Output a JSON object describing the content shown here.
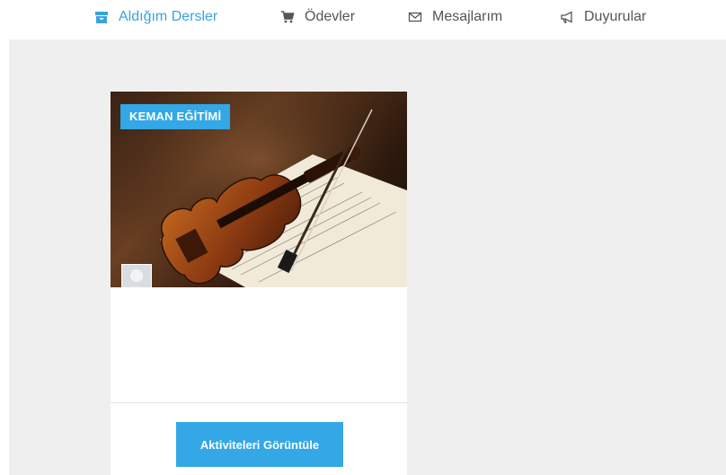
{
  "nav": {
    "tabs": [
      {
        "label": "Aldığım Dersler",
        "icon": "archive-box-icon",
        "active": true
      },
      {
        "label": "Ödevler",
        "icon": "cart-icon",
        "active": false
      },
      {
        "label": "Mesajlarım",
        "icon": "envelope-icon",
        "active": false
      },
      {
        "label": "Duyurular",
        "icon": "megaphone-icon",
        "active": false
      }
    ]
  },
  "card": {
    "badge": "KEMAN EĞİTİMİ",
    "button_label": "Aktiviteleri Görüntüle"
  },
  "colors": {
    "accent": "#34a7e6",
    "tab_inactive": "#555555",
    "content_bg": "#efefef"
  }
}
